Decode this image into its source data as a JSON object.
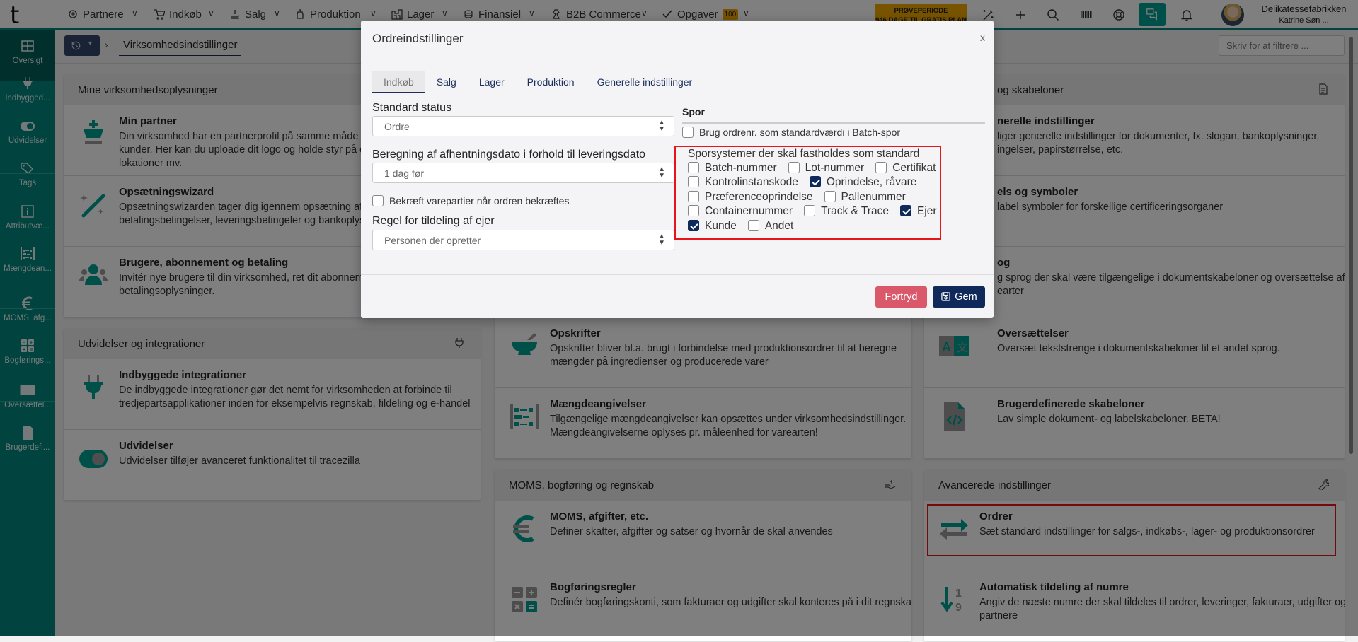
{
  "topbar": {
    "logo": "t",
    "nav": [
      {
        "label": "Partnere",
        "icon": "partners-icon"
      },
      {
        "label": "Indkøb",
        "icon": "cart-icon"
      },
      {
        "label": "Salg",
        "icon": "sales-icon"
      },
      {
        "label": "Produktion",
        "icon": "production-icon"
      },
      {
        "label": "Lager",
        "icon": "warehouse-icon"
      },
      {
        "label": "Finansiel",
        "icon": "finance-icon"
      },
      {
        "label": "B2B Commerce",
        "icon": "b2b-icon"
      },
      {
        "label": "Opgaver",
        "icon": "check-icon",
        "badge": "100"
      }
    ],
    "trial_line1": "PRØVEPERIODE",
    "trial_line2": "946 DAGE TIL GRATIS PLAN",
    "company": "Delikatessefabrikken",
    "user": "Katrine Søn ..."
  },
  "sidebar": {
    "items": [
      {
        "label": "Oversigt",
        "icon": "grid-icon",
        "active": true
      },
      {
        "label": "Indbygged...",
        "icon": "plug-icon"
      },
      {
        "label": "Udvidelser",
        "icon": "toggle-icon"
      },
      {
        "label": "Tags",
        "icon": "tags-icon"
      },
      {
        "label": "Attributvæ...",
        "icon": "info-icon"
      },
      {
        "label": "Mængdean...",
        "icon": "abacus-icon"
      },
      {
        "label": "MOMS, afg...",
        "icon": "euro-icon"
      },
      {
        "label": "Bogførings...",
        "icon": "calculator-icon"
      },
      {
        "label": "Oversættel...",
        "icon": "translate-icon"
      },
      {
        "label": "Brugerdefi...",
        "icon": "code-file-icon"
      }
    ]
  },
  "breadcrumb": {
    "current": "Virksomhedsindstillinger"
  },
  "filter": {
    "placeholder": "Skriv for at filtrere ..."
  },
  "cards": [
    {
      "title": "Mine virksomhedsoplysninger",
      "items": [
        {
          "title": "Min partner",
          "icon": "chess-king-icon",
          "desc": [
            "Din virksomhed har en partnerprofil på samme måde som",
            "kunder. Her kan du uploade dit logo og holde styr på dine",
            "lokationer mv."
          ]
        },
        {
          "title": "Opsætningswizard",
          "icon": "magic-wand-icon",
          "desc": [
            "Opsætningswizarden tager dig igennem opsætning af bl.a.",
            "betalingsbetingelser, leveringsbetingeler og bankoplysninger"
          ]
        },
        {
          "title": "Brugere, abonnement og betaling",
          "icon": "users-icon",
          "desc": [
            "Invitér nye brugere til din virksomhed, ret dit abonnement",
            "betalingsoplysninger."
          ]
        }
      ]
    },
    {
      "title": "Udvidelser og integrationer",
      "header_icon": "plug-icon",
      "items": [
        {
          "title": "Indbyggede integrationer",
          "icon": "plug-icon",
          "desc": [
            "De indbyggede integrationer gør det nemt for virksomheden at forbinde til",
            "tredjepartsapplikationer inden for eksempelvis regnskab, fildeling og e-handel"
          ]
        },
        {
          "title": "Udvidelser",
          "icon": "toggle-icon",
          "desc": [
            "Udvidelser tilføjer avanceret funktionalitet til tracezilla"
          ]
        }
      ]
    },
    {
      "title": "",
      "items": [
        {
          "title": "",
          "icon": "",
          "desc": []
        },
        {
          "title": "",
          "icon": "",
          "desc": []
        },
        {
          "title": "",
          "icon": "",
          "desc": []
        },
        {
          "title": "Opskrifter",
          "icon": "mortar-icon",
          "desc": [
            "Opskrifter bliver bl.a. brugt i forbindelse med produktionsordrer til at beregne",
            "mængder på ingredienser og producerede varer"
          ]
        },
        {
          "title": "Mængdeangivelser",
          "icon": "abacus-icon",
          "desc": [
            "Tilgængelige mængdeangivelser kan opsættes under virksomhedsindstillinger.",
            "Mængdeangivelserne oplyses pr. måleenhed for varearten!"
          ]
        }
      ]
    },
    {
      "title": "MOMS, bogføring og regnskab",
      "header_icon": "hand-money-icon",
      "items": [
        {
          "title": "MOMS, afgifter, etc.",
          "icon": "euro-icon",
          "desc": [
            "Definer skatter, afgifter og satser og hvornår de skal anvendes"
          ]
        },
        {
          "title": "Bogføringsregler",
          "icon": "calculator-icon",
          "desc": [
            "Definér bogføringskonti, som fakturaer og udgifter skal konteres på i dit regnskab"
          ]
        }
      ]
    },
    {
      "title": "og skabeloner",
      "header_icon": "document-icon",
      "items": [
        {
          "title": "nerelle indstillinger",
          "icon": "",
          "desc": [
            "liger generelle indstillinger for dokumenter, fx. slogan, bankoplysninger,",
            "ingelser, papirstørrelse, etc."
          ]
        },
        {
          "title": "els og symboler",
          "icon": "",
          "desc": [
            "label symboler for forskellige certificeringsorganer"
          ]
        },
        {
          "title": "og",
          "icon": "",
          "desc": [
            "g sprog der skal være tilgængelige i dokumentskabeloner og oversættelse af",
            "earter"
          ]
        },
        {
          "title": "Oversættelser",
          "icon": "translate-icon",
          "desc": [
            "Oversæt tekststrenge i dokumentskabeloner til et andet sprog."
          ]
        },
        {
          "title": "Brugerdefinerede skabeloner",
          "icon": "code-file-icon",
          "desc": [
            "Lav simple dokument- og labelskabeloner. BETA!"
          ]
        }
      ]
    },
    {
      "title": "Avancerede indstillinger",
      "header_icon": "wrench-icon",
      "items": [
        {
          "title": "Ordrer",
          "icon": "swap-arrows-icon",
          "highlighted": true,
          "desc": [
            "Sæt standard indstillinger for salgs-, indkøbs-, lager- og produktionsordrer"
          ]
        },
        {
          "title": "Automatisk tildeling af numre",
          "icon": "sort-numeric-icon",
          "desc": [
            "Angiv de næste numre der skal tildeles til ordrer, leveringer, fakturaer, udgifter og",
            "partnere"
          ]
        }
      ]
    }
  ],
  "modal": {
    "title": "Ordreindstillinger",
    "close": "x",
    "tabs": [
      "Indkøb",
      "Salg",
      "Lager",
      "Produktion",
      "Generelle indstillinger"
    ],
    "active_tab": "Indkøb",
    "standard_status": {
      "label": "Standard status",
      "value": "Ordre"
    },
    "pickup_calc": {
      "label": "Beregning af afhentningsdato i forhold til leveringsdato",
      "value": "1 dag før"
    },
    "confirm_batches": {
      "label": "Bekræft varepartier når ordren bekræftes",
      "checked": false
    },
    "owner_rule": {
      "label": "Regel for tildeling af ejer",
      "value": "Personen der opretter"
    },
    "spor": {
      "heading": "Spor",
      "use_order_no": {
        "label": "Brug ordrenr. som standardværdi i Batch-spor",
        "checked": false
      },
      "systems_label": "Sporsystemer der skal fastholdes som standard",
      "options": [
        {
          "label": "Batch-nummer",
          "checked": false
        },
        {
          "label": "Lot-nummer",
          "checked": false
        },
        {
          "label": "Certifikat",
          "checked": false
        },
        {
          "label": "Kontrolinstanskode",
          "checked": false
        },
        {
          "label": "Oprindelse, råvare",
          "checked": true
        },
        {
          "label": "Præferenceoprindelse",
          "checked": false
        },
        {
          "label": "Pallenummer",
          "checked": false
        },
        {
          "label": "Containernummer",
          "checked": false
        },
        {
          "label": "Track & Trace",
          "checked": false
        },
        {
          "label": "Ejer",
          "checked": true
        },
        {
          "label": "Kunde",
          "checked": true
        },
        {
          "label": "Andet",
          "checked": false
        }
      ]
    },
    "cancel": "Fortryd",
    "save": "Gem"
  },
  "colors": {
    "brand_teal": "#00867e",
    "navy": "#0f2a5a",
    "cancel": "#d9596a",
    "highlight": "#e8141c",
    "trial": "#f0a800"
  }
}
